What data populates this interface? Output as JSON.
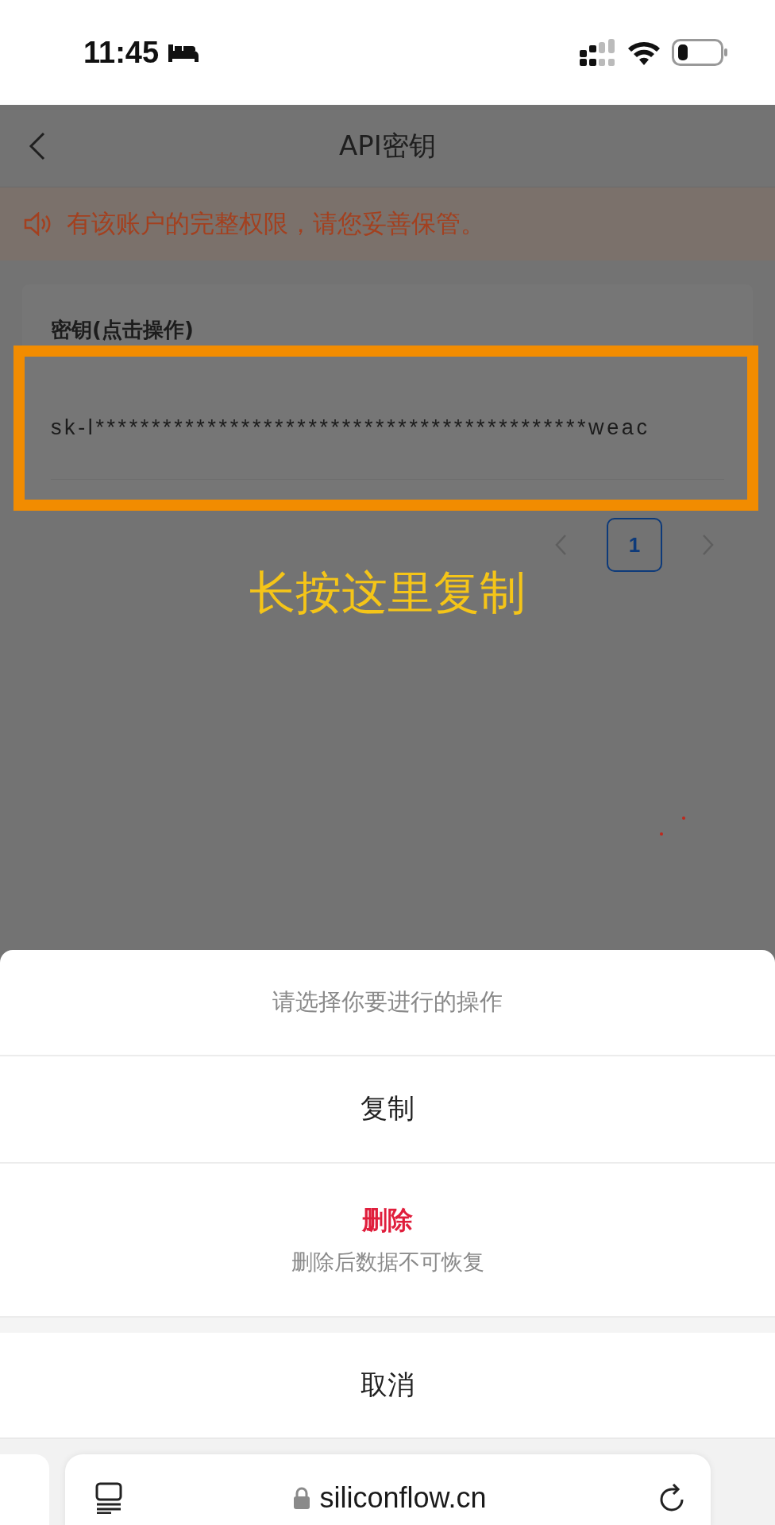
{
  "status_bar": {
    "time": "11:45"
  },
  "header": {
    "title": "API密钥"
  },
  "notice": {
    "text": "有该账户的完整权限，请您妥善保管。"
  },
  "key_card": {
    "label": "密钥(点击操作)",
    "key": "sk-l********************************************weac"
  },
  "annotation": {
    "text": "长按这里复制"
  },
  "pagination": {
    "pages": [
      {
        "label": "1",
        "selected": true
      }
    ]
  },
  "action_sheet": {
    "title": "请选择你要进行的操作",
    "actions": [
      {
        "kind": "normal",
        "label": "复制"
      },
      {
        "kind": "destructive",
        "label": "删除",
        "description": "删除后数据不可恢复"
      }
    ],
    "cancel": "取消"
  },
  "browser_bar": {
    "url": "siliconflow.cn"
  }
}
